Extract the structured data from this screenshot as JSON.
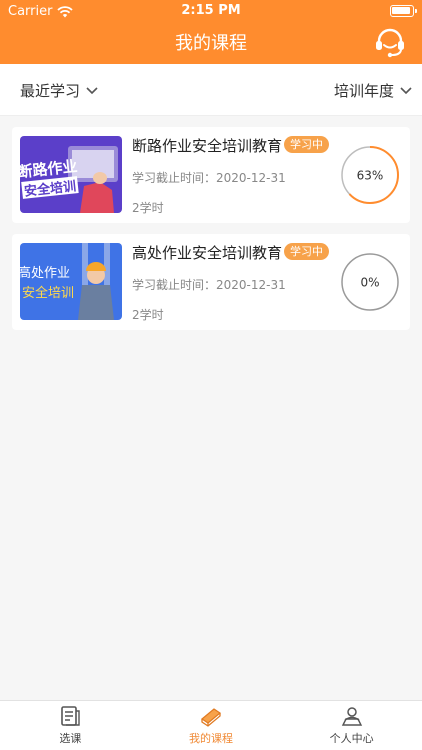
{
  "status": {
    "carrier": "Carrier",
    "time": "2:15 PM"
  },
  "header": {
    "title": "我的课程",
    "support_icon": "headset-icon"
  },
  "filters": {
    "left_label": "最近学习",
    "right_label": "培训年度"
  },
  "colors": {
    "accent": "#ff8c2e",
    "badge": "#f7a24a"
  },
  "courses": [
    {
      "title": "断路作业安全培训教育",
      "badge": "学习中",
      "deadline": "学习截止时间：2020-12-31",
      "hours": "2学时",
      "progress_label": "63%",
      "progress": 0.63,
      "thumb_text_line1": "断路作业",
      "thumb_text_line2": "安全培训"
    },
    {
      "title": "高处作业安全培训教育",
      "badge": "学习中",
      "deadline": "学习截止时间：2020-12-31",
      "hours": "2学时",
      "progress_label": "0%",
      "progress": 0,
      "thumb_text_line1": "高处作业",
      "thumb_text_line2": "安全培训"
    }
  ],
  "tabs": [
    {
      "label": "选课",
      "icon": "document-icon"
    },
    {
      "label": "我的课程",
      "icon": "book-icon"
    },
    {
      "label": "个人中心",
      "icon": "user-icon"
    }
  ]
}
